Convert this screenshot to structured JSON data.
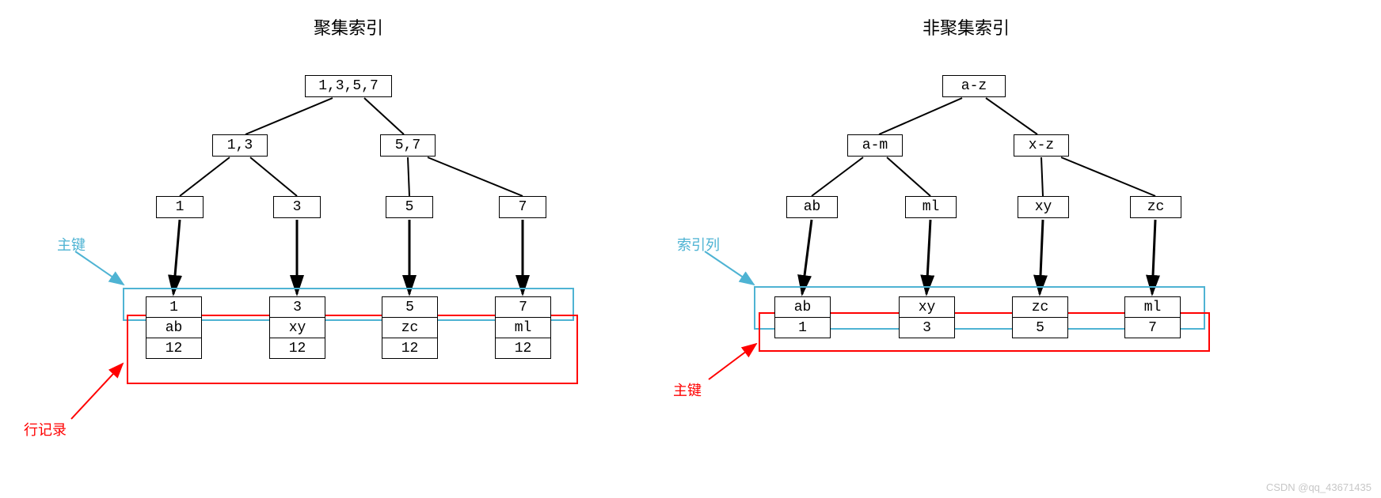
{
  "left": {
    "title": "聚集索引",
    "root": "1,3,5,7",
    "level2": [
      "1,3",
      "5,7"
    ],
    "level3": [
      "1",
      "3",
      "5",
      "7"
    ],
    "leaves": [
      {
        "row1": "1",
        "row2": "ab",
        "row3": "12"
      },
      {
        "row1": "3",
        "row2": "xy",
        "row3": "12"
      },
      {
        "row1": "5",
        "row2": "zc",
        "row3": "12"
      },
      {
        "row1": "7",
        "row2": "ml",
        "row3": "12"
      }
    ],
    "label_blue": "主键",
    "label_red": "行记录",
    "colors": {
      "blue": "#4eb3d3",
      "red": "#ff0000"
    }
  },
  "right": {
    "title": "非聚集索引",
    "root": "a-z",
    "level2": [
      "a-m",
      "x-z"
    ],
    "level3": [
      "ab",
      "ml",
      "xy",
      "zc"
    ],
    "leaves": [
      {
        "row1": "ab",
        "row2": "1"
      },
      {
        "row1": "xy",
        "row2": "3"
      },
      {
        "row1": "zc",
        "row2": "5"
      },
      {
        "row1": "ml",
        "row2": "7"
      }
    ],
    "label_blue": "索引列",
    "label_red": "主键",
    "colors": {
      "blue": "#4eb3d3",
      "red": "#ff0000"
    }
  },
  "watermark": "CSDN @qq_43671435"
}
